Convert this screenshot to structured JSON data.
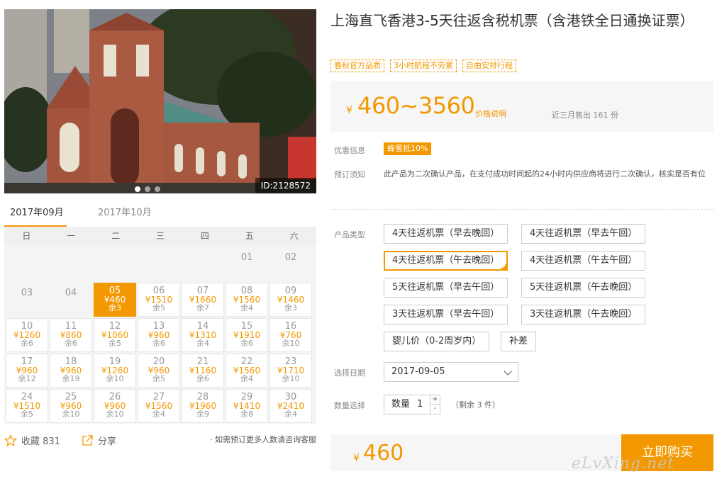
{
  "photo": {
    "id_label": "ID:2128572",
    "dots": 3
  },
  "calendar": {
    "months": [
      "2017年09月",
      "2017年10月"
    ],
    "weekdays": [
      "日",
      "一",
      "二",
      "三",
      "四",
      "五",
      "六"
    ],
    "leading_blank": 5,
    "days": [
      {
        "d": "01"
      },
      {
        "d": "02"
      },
      {
        "d": "03"
      },
      {
        "d": "04"
      },
      {
        "d": "05",
        "p": "¥460",
        "s": "余3",
        "selected": true
      },
      {
        "d": "06",
        "p": "¥1510",
        "s": "余5"
      },
      {
        "d": "07",
        "p": "¥1660",
        "s": "余7"
      },
      {
        "d": "08",
        "p": "¥1560",
        "s": "余4"
      },
      {
        "d": "09",
        "p": "¥1460",
        "s": "余3"
      },
      {
        "d": "10",
        "p": "¥1260",
        "s": "余6"
      },
      {
        "d": "11",
        "p": "¥860",
        "s": "余6"
      },
      {
        "d": "12",
        "p": "¥1060",
        "s": "余5"
      },
      {
        "d": "13",
        "p": "¥960",
        "s": "余6"
      },
      {
        "d": "14",
        "p": "¥1310",
        "s": "余4"
      },
      {
        "d": "15",
        "p": "¥1910",
        "s": "余6"
      },
      {
        "d": "16",
        "p": "¥760",
        "s": "余10"
      },
      {
        "d": "17",
        "p": "¥960",
        "s": "余12"
      },
      {
        "d": "18",
        "p": "¥960",
        "s": "余19"
      },
      {
        "d": "19",
        "p": "¥1260",
        "s": "余10"
      },
      {
        "d": "20",
        "p": "¥960",
        "s": "余5"
      },
      {
        "d": "21",
        "p": "¥1160",
        "s": "余6"
      },
      {
        "d": "22",
        "p": "¥1560",
        "s": "余4"
      },
      {
        "d": "23",
        "p": "¥1710",
        "s": "余10"
      },
      {
        "d": "24",
        "p": "¥1510",
        "s": "余5"
      },
      {
        "d": "25",
        "p": "¥960",
        "s": "余10"
      },
      {
        "d": "26",
        "p": "¥960",
        "s": "余10"
      },
      {
        "d": "27",
        "p": "¥1560",
        "s": "余4"
      },
      {
        "d": "28",
        "p": "¥1960",
        "s": "余9"
      },
      {
        "d": "29",
        "p": "¥1410",
        "s": "余8"
      },
      {
        "d": "30",
        "p": "¥2410",
        "s": "余4"
      }
    ]
  },
  "share_bar": {
    "favorite": "收藏 831",
    "share": "分享",
    "tip": "· 如需预订更多人数请咨询客服"
  },
  "product": {
    "title": "上海直飞香港3-5天往返含税机票（含港铁全日通换证票）",
    "tags": [
      "春秋官方品质",
      "3小时航程不劳累",
      "自由安排行程"
    ],
    "price_currency": "¥",
    "price_range": "460~3560",
    "price_explain": "价格说明",
    "sold": "近三月售出 161 份"
  },
  "promo": {
    "label": "优惠信息",
    "badge": "蜂蜜抵10%"
  },
  "notice": {
    "label": "预订须知",
    "text": "此产品为二次确认产品，在支付成功时间起的24小时内供应商将进行二次确认，核实是否有位"
  },
  "options": {
    "label": "产品类型",
    "items": [
      "4天往返机票（早去晚回）",
      "4天往返机票（早去午回）",
      "4天往返机票（午去晚回）",
      "4天往返机票（午去午回）",
      "5天往返机票（早去午回）",
      "5天往返机票（午去晚回）",
      "3天往返机票（早去午回）",
      "3天往返机票（午去晚回）",
      "婴儿价（0-2周岁内）",
      "补差"
    ],
    "selected": 2
  },
  "date_pick": {
    "label": "选择日期",
    "value": "2017-09-05"
  },
  "quantity": {
    "label": "数量选择",
    "field_label": "数量",
    "value": "1",
    "plus": "+",
    "minus": "-",
    "remain": "（剩余 3 件）"
  },
  "buy": {
    "currency": "¥",
    "amount": "460",
    "button": "立即购买"
  },
  "watermark": "eLvXing.net"
}
